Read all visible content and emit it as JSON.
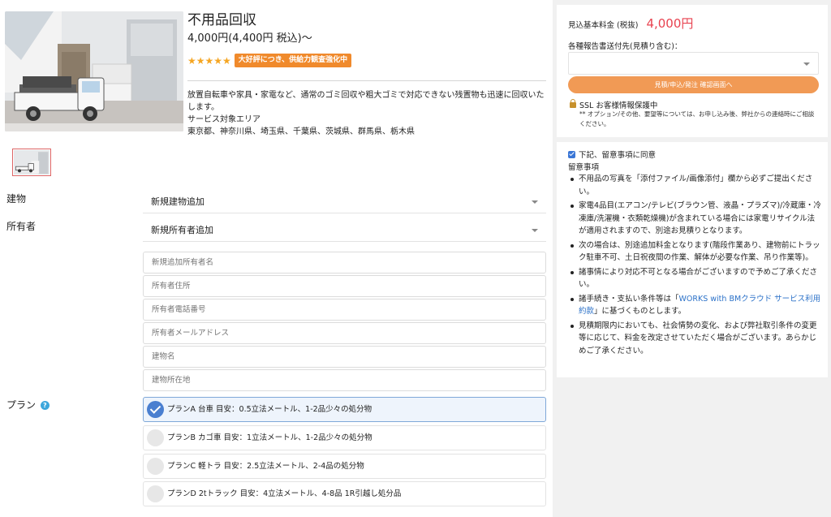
{
  "product": {
    "title": "不用品回収",
    "price": "4,000円(4,400円 税込)～",
    "stars": "★★★★★",
    "badge": "大好評につき、供給力観査強化中",
    "description": "放置自転車や家具・家電など、通常のゴミ回収や粗大ゴミで対応できない残置物も迅速に回収いたします。",
    "area_label": "サービス対象エリア",
    "area_list": "東京都、神奈川県、埼玉県、千葉県、茨城県、群馬県、栃木県"
  },
  "form": {
    "building_label": "建物",
    "building_value": "新規建物追加",
    "owner_label": "所有者",
    "owner_value": "新規所有者追加",
    "fields": [
      "新規追加所有者名",
      "所有者住所",
      "所有者電話番号",
      "所有者メールアドレス",
      "建物名",
      "建物所在地"
    ],
    "plan_label": "プラン",
    "help_icon": "?",
    "plans": [
      "プランA 台車 目安：0.5立法メートル、1-2品少々の処分物",
      "プランB カゴ車 目安：1立法メートル、1-2品少々の処分物",
      "プランC 軽トラ 目安：2.5立法メートル、2-4品の処分物",
      "プランD 2tトラック 目安：4立法メートル、4-8品 1R引越し処分品"
    ],
    "selected_plan": 0
  },
  "sidebar": {
    "quote_label": "見込基本料金 (税抜)",
    "quote_value": "4,000円",
    "dest_label": "各種報告書送付先(見積り含む)：",
    "confirm_button": "見積/申込/発注 確認画面へ",
    "ssl_text": "SSL お客様情報保護中",
    "ssl_note": "** オプション/その他、要望等については、お申し込み後、弊社からの連絡時にご相談ください。",
    "agree_label": "下記、留意事項に同意",
    "notes_title": "留意事項",
    "notes": [
      {
        "text": "不用品の写真を「添付ファイル/画像添付」欄から必ずご提出ください。"
      },
      {
        "text": "家電4品目(エアコン/テレビ(ブラウン管、液晶・プラズマ)/冷蔵庫・冷凍庫/洗濯機・衣類乾燥機)が含まれている場合には家電リサイクル法が適用されますので、別途お見積りとなります。"
      },
      {
        "text": "次の場合は、別途追加料金となります(階段作業あり、建物前にトラック駐車不可、土日祝夜間の作業、解体が必要な作業、吊り作業等)。"
      },
      {
        "text": "諸事情により対応不可となる場合がございますので予めご了承ください。"
      },
      {
        "pre": "諸手続き・支払い条件等は「",
        "link": "WORKS with BMクラウド サービス利用約款",
        "post": "」に基づくものとします。"
      },
      {
        "text": "見積期限内においても、社会情勢の変化、および弊社取引条件の変更等に応じて、料金を改定させていただく場合がございます。あらかじめご了承ください。"
      }
    ]
  },
  "colors": {
    "accent_orange": "#f19a55",
    "price_red": "#e8424f",
    "selected_blue": "#4a7fd0",
    "link_blue": "#2b71c8"
  }
}
